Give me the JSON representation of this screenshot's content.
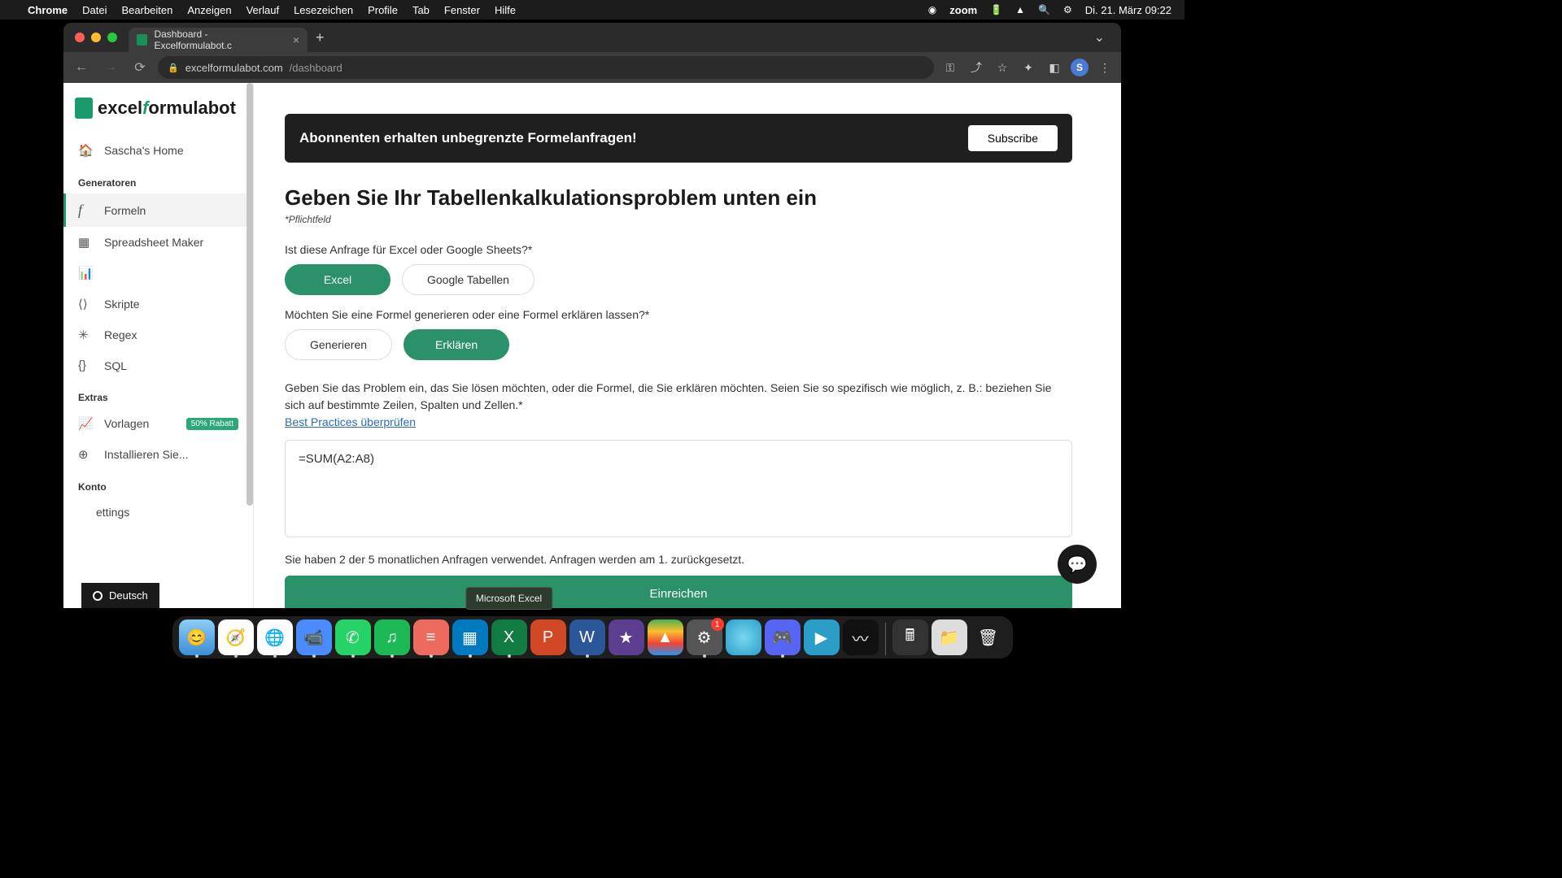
{
  "menubar": {
    "app": "Chrome",
    "items": [
      "Datei",
      "Bearbeiten",
      "Anzeigen",
      "Verlauf",
      "Lesezeichen",
      "Profile",
      "Tab",
      "Fenster",
      "Hilfe"
    ],
    "zoom": "zoom",
    "datetime": "Di. 21. März  09:22"
  },
  "browser": {
    "tab_title": "Dashboard - Excelformulabot.c",
    "url_host": "excelformulabot.com",
    "url_path": "/dashboard",
    "avatar": "S"
  },
  "sidebar": {
    "logo_pre": "excel",
    "logo_f": "f",
    "logo_post": "ormulabot",
    "home": "Sascha's Home",
    "section_gen": "Generatoren",
    "formeln": "Formeln",
    "spreadsheet": "Spreadsheet Maker",
    "item_chart": "",
    "skripte": "Skripte",
    "regex": "Regex",
    "sql": "SQL",
    "section_extras": "Extras",
    "vorlagen": "Vorlagen",
    "vorlagen_badge": "50% Rabatt",
    "install": "Installieren Sie...",
    "section_konto": "Konto",
    "settings": "ettings",
    "lang": "Deutsch"
  },
  "main": {
    "banner_text": "Abonnenten erhalten unbegrenzte Formelanfragen!",
    "subscribe": "Subscribe",
    "heading": "Geben Sie Ihr Tabellenkalkulationsproblem unten ein",
    "required": "*Pflichtfeld",
    "q1": "Ist diese Anfrage für Excel oder Google Sheets?*",
    "opt_excel": "Excel",
    "opt_gsheets": "Google Tabellen",
    "q2": "Möchten Sie eine Formel generieren oder eine Formel erklären lassen?*",
    "opt_gen": "Generieren",
    "opt_exp": "Erklären",
    "prompt_label": "Geben Sie das Problem ein, das Sie lösen möchten, oder die Formel, die Sie erklären möchten. Seien Sie so spezifisch wie möglich, z. B.: beziehen Sie sich auf bestimmte Zeilen, Spalten und Zellen.*",
    "best_practices": "Best Practices überprüfen",
    "formula_value": "=SUM(A2:A8)",
    "usage": "Sie haben 2 der 5 monatlichen Anfragen verwendet. Anfragen werden am 1. zurückgesetzt.",
    "submit": "Einreichen"
  },
  "dock": {
    "tooltip": "Microsoft Excel",
    "badge_settings": "1"
  }
}
